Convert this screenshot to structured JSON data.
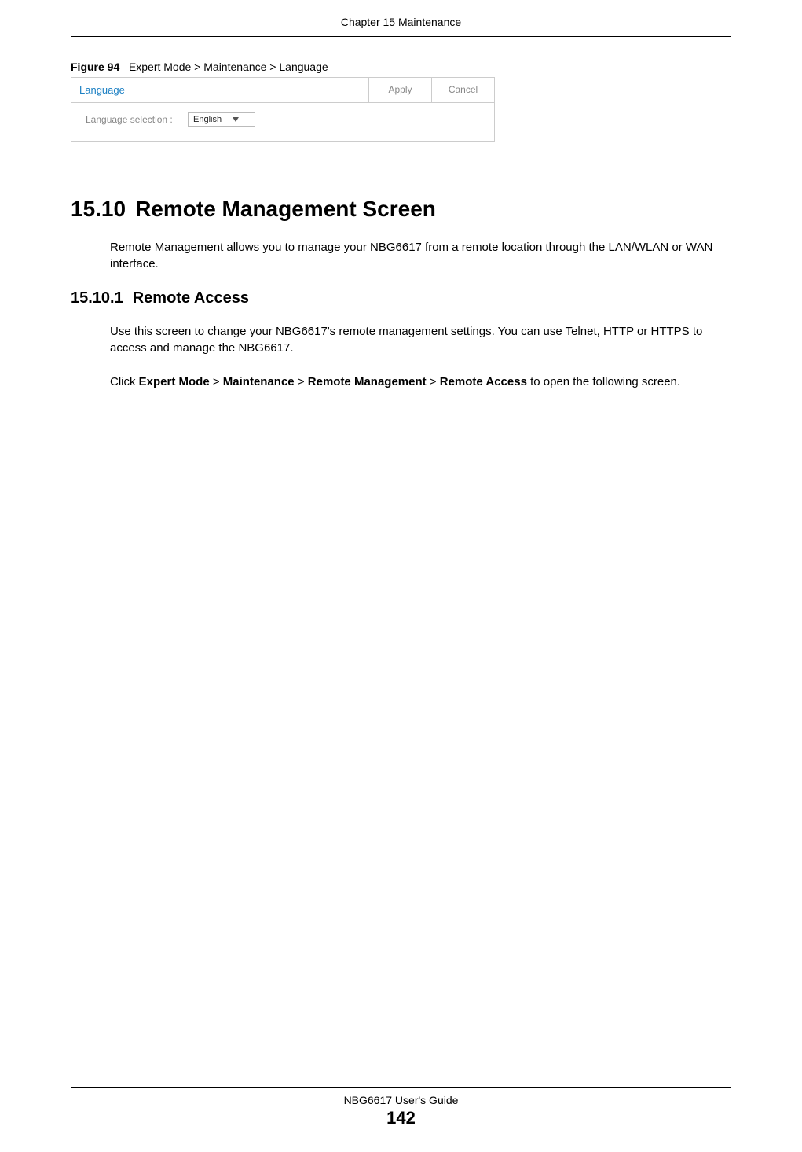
{
  "header": {
    "chapter": "Chapter 15 Maintenance"
  },
  "figure": {
    "label": "Figure 94",
    "caption": "Expert Mode > Maintenance > Language",
    "panel_title": "Language",
    "apply_btn": "Apply",
    "cancel_btn": "Cancel",
    "field_label": "Language selection :",
    "select_value": "English"
  },
  "section": {
    "number": "15.10",
    "title": "Remote Management Screen",
    "body": "Remote Management allows you to manage your NBG6617 from a remote location through the LAN/WLAN or WAN interface."
  },
  "subsection": {
    "number": "15.10.1",
    "title": "Remote Access",
    "p1": "Use this screen to change your NBG6617's remote management settings. You can use Telnet,  HTTP or HTTPS to access and manage the NBG6617.",
    "p2_pre": "Click ",
    "p2_b1": "Expert Mode",
    "p2_sep": " > ",
    "p2_b2": "Maintenance",
    "p2_b3": "Remote Management",
    "p2_b4": "Remote Access",
    "p2_post": " to open the following screen."
  },
  "footer": {
    "guide": "NBG6617 User's Guide",
    "page": "142"
  }
}
